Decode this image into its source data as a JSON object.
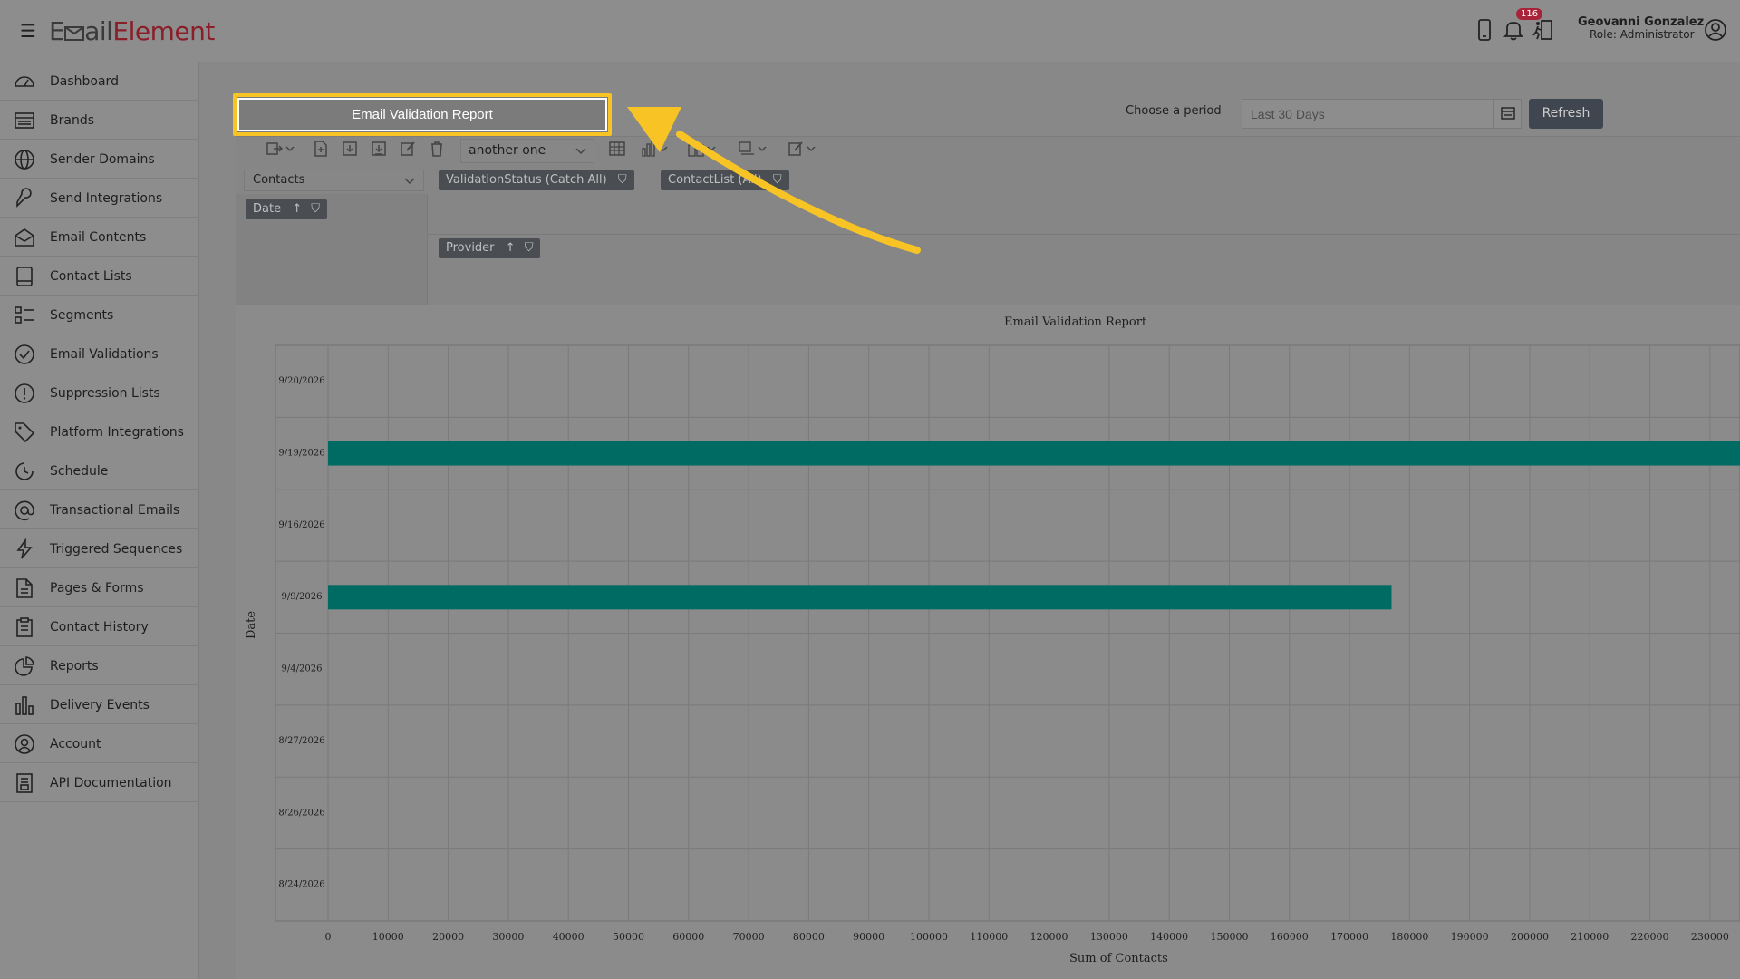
{
  "header": {
    "logo_part1": "E",
    "logo_part2": "ail",
    "logo_part3": "Element",
    "notification_count": "116",
    "user_name": "Geovanni Gonzalez",
    "user_role": "Role: Administrator"
  },
  "sidebar": {
    "items": [
      {
        "label": "Dashboard",
        "icon": "dashboard-icon"
      },
      {
        "label": "Brands",
        "icon": "brands-icon"
      },
      {
        "label": "Sender Domains",
        "icon": "globe-icon"
      },
      {
        "label": "Send Integrations",
        "icon": "wrench-icon"
      },
      {
        "label": "Email Contents",
        "icon": "envelope-open-icon"
      },
      {
        "label": "Contact Lists",
        "icon": "book-icon"
      },
      {
        "label": "Segments",
        "icon": "segments-icon"
      },
      {
        "label": "Email Validations",
        "icon": "check-circle-icon"
      },
      {
        "label": "Suppression Lists",
        "icon": "exclamation-circle-icon"
      },
      {
        "label": "Platform Integrations",
        "icon": "tag-icon"
      },
      {
        "label": "Schedule",
        "icon": "clock-icon"
      },
      {
        "label": "Transactional Emails",
        "icon": "at-icon"
      },
      {
        "label": "Triggered Sequences",
        "icon": "lightning-icon"
      },
      {
        "label": "Pages & Forms",
        "icon": "file-icon"
      },
      {
        "label": "Contact History",
        "icon": "clipboard-icon"
      },
      {
        "label": "Reports",
        "icon": "pie-chart-icon"
      },
      {
        "label": "Delivery Events",
        "icon": "bar-chart-icon"
      },
      {
        "label": "Account",
        "icon": "user-circle-icon"
      },
      {
        "label": "API Documentation",
        "icon": "api-doc-icon"
      }
    ]
  },
  "report": {
    "title_button": "Email Validation Report",
    "period_label": "Choose a period",
    "period_value": "Last 30 Days",
    "refresh_label": "Refresh"
  },
  "pivot": {
    "layout_select": "another one",
    "measure_select": "Contacts",
    "filter_chips": [
      "ValidationStatus (Catch All)",
      "ContactList (All)"
    ],
    "row_chip": "Date",
    "column_chip": "Provider"
  },
  "chart_data": {
    "type": "bar",
    "orientation": "horizontal",
    "title": "Email Validation Report",
    "xlabel": "Sum of Contacts",
    "ylabel": "Date",
    "categories": [
      "9/20/2026",
      "9/19/2026",
      "9/16/2026",
      "9/9/2026",
      "9/4/2026",
      "8/27/2026",
      "8/26/2026",
      "8/24/2026"
    ],
    "values": [
      0,
      235000,
      0,
      177000,
      0,
      0,
      0,
      0
    ],
    "xlim": [
      0,
      235000
    ],
    "x_ticks": [
      0,
      10000,
      20000,
      30000,
      40000,
      50000,
      60000,
      70000,
      80000,
      90000,
      100000,
      110000,
      120000,
      130000,
      140000,
      150000,
      160000,
      170000,
      180000,
      190000,
      200000,
      210000,
      220000,
      230000
    ],
    "bar_color": "#006b63",
    "grid": true
  }
}
